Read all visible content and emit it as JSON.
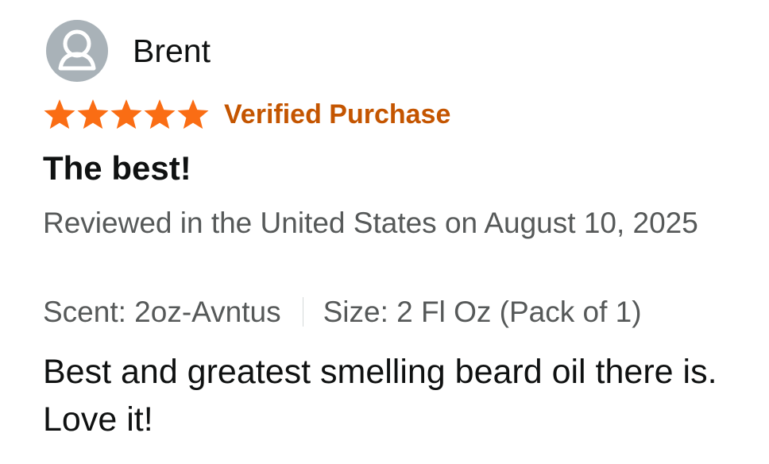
{
  "review": {
    "profile_name": "Brent",
    "avatar_icon": "user-silhouette-icon",
    "rating": 5,
    "rating_max": 5,
    "star_icon": "filled-star-icon",
    "verified_label": "Verified Purchase",
    "title": "The best!",
    "review_location_date": "Reviewed in the United States on August 10, 2025",
    "variants": {
      "scent": "Scent: 2oz-Avntus",
      "size": "Size: 2 Fl Oz (Pack of 1)"
    },
    "body": "Best and greatest smelling beard oil there is. Love it!"
  },
  "colors": {
    "star": "#fa6d14",
    "verified": "#c45500",
    "avatar_background": "#a9b2b8",
    "secondary_text": "#565959",
    "primary_text": "#0f1111"
  }
}
